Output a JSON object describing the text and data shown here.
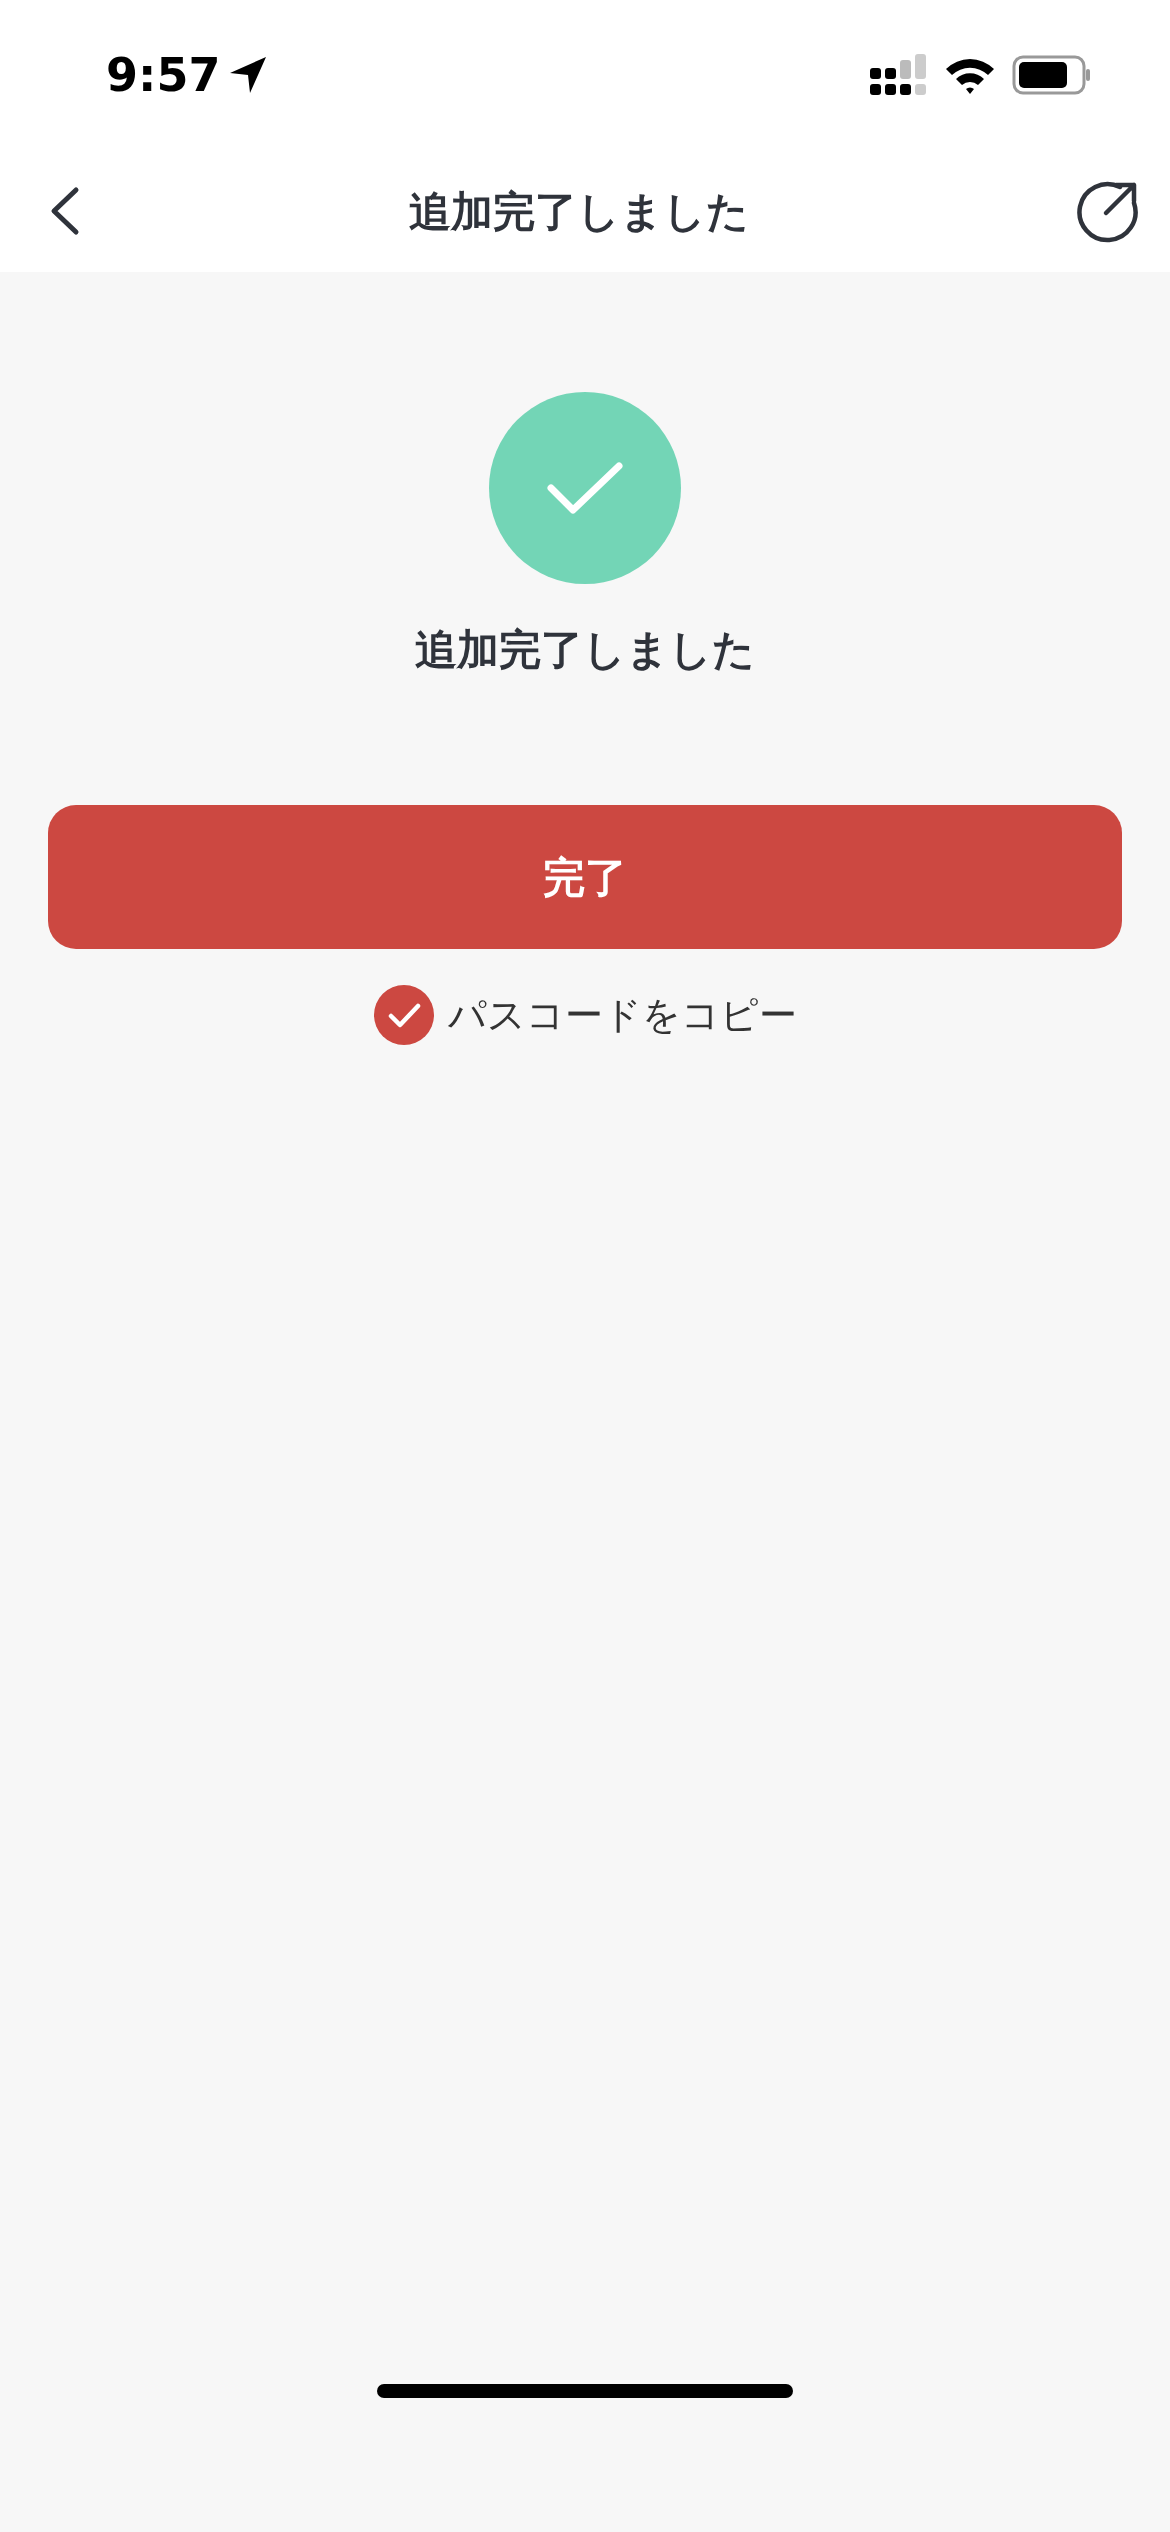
{
  "status_bar": {
    "time": "9:57"
  },
  "header": {
    "title": "追加完了しました"
  },
  "result": {
    "message": "追加完了しました"
  },
  "done_button": {
    "label": "完了"
  },
  "copy_passcode": {
    "label": "パスコードをコピー",
    "checked": true
  }
}
